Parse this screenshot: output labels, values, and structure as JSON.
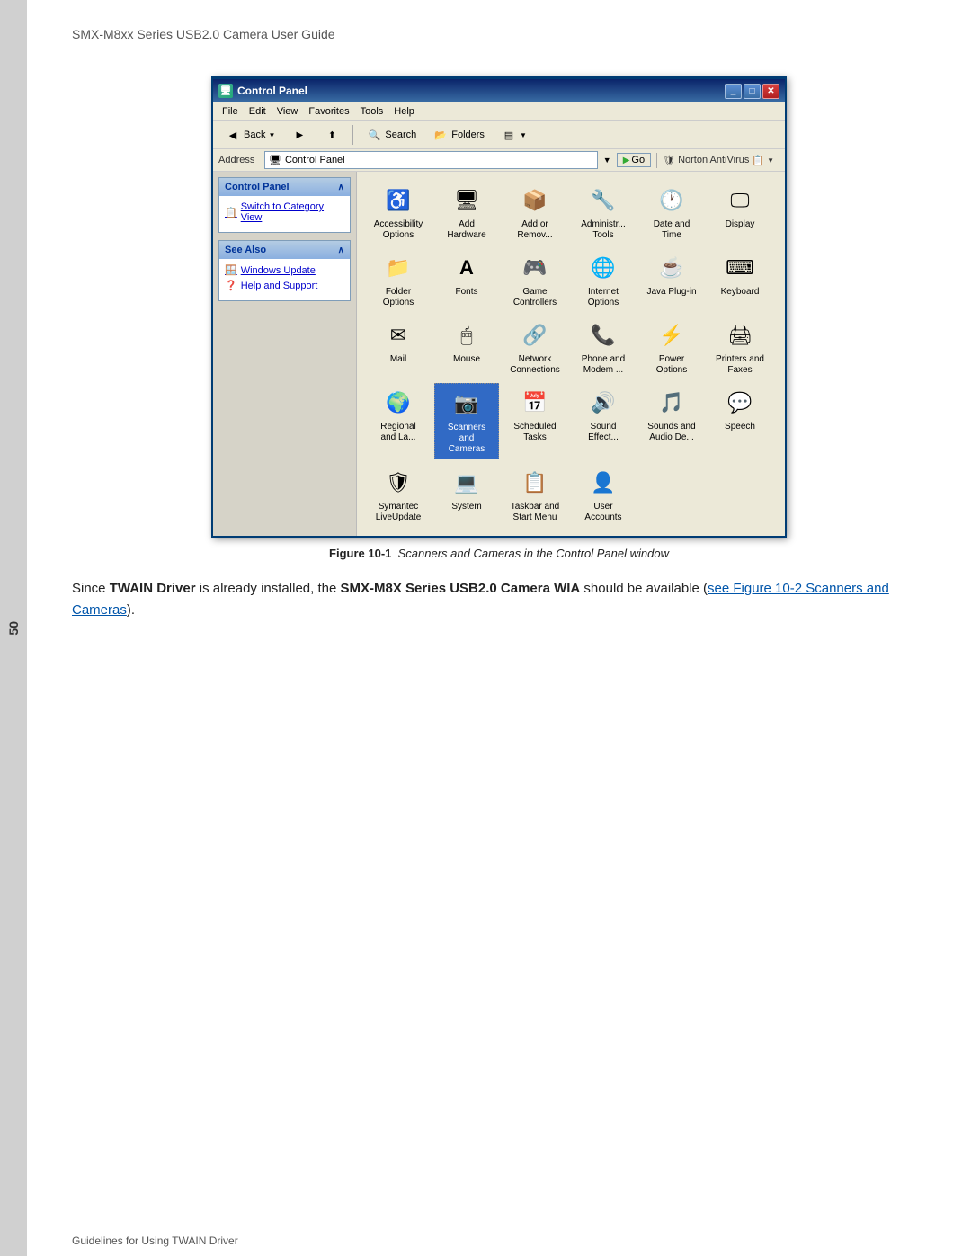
{
  "page": {
    "number": "50",
    "header_title": "SMX-M8xx Series USB2.0 Camera User Guide",
    "footer_title": "Guidelines for Using TWAIN Driver"
  },
  "window": {
    "title": "Control Panel",
    "menus": [
      "File",
      "Edit",
      "View",
      "Favorites",
      "Tools",
      "Help"
    ],
    "toolbar": {
      "back_label": "Back",
      "search_label": "Search",
      "folders_label": "Folders"
    },
    "address": {
      "label": "Address",
      "value": "Control Panel",
      "go_label": "Go"
    },
    "norton_label": "Norton AntiVirus",
    "sidebar": {
      "control_panel_header": "Control Panel",
      "switch_label": "Switch to Category View",
      "see_also_header": "See Also",
      "links": [
        "Windows Update",
        "Help and Support"
      ]
    },
    "icons": [
      {
        "id": "accessibility",
        "label": "Accessibility\nOptions",
        "icon": "♿"
      },
      {
        "id": "hardware",
        "label": "Add\nHardware",
        "icon": "🖥"
      },
      {
        "id": "addremove",
        "label": "Add or\nRemov...",
        "icon": "📦"
      },
      {
        "id": "admintools",
        "label": "Administr...\nTools",
        "icon": "🔧"
      },
      {
        "id": "datetime",
        "label": "Date and\nTime",
        "icon": "🕐"
      },
      {
        "id": "display",
        "label": "Display",
        "icon": "🖵"
      },
      {
        "id": "folderoptions",
        "label": "Folder\nOptions",
        "icon": "📁"
      },
      {
        "id": "fonts",
        "label": "Fonts",
        "icon": "A"
      },
      {
        "id": "game",
        "label": "Game\nControllers",
        "icon": "🎮"
      },
      {
        "id": "internet",
        "label": "Internet\nOptions",
        "icon": "🌐"
      },
      {
        "id": "java",
        "label": "Java Plug-in",
        "icon": "☕"
      },
      {
        "id": "keyboard",
        "label": "Keyboard",
        "icon": "⌨"
      },
      {
        "id": "mail",
        "label": "Mail",
        "icon": "✉"
      },
      {
        "id": "mouse",
        "label": "Mouse",
        "icon": "🖱"
      },
      {
        "id": "network",
        "label": "Network\nConnections",
        "icon": "🔗"
      },
      {
        "id": "phone",
        "label": "Phone and\nModem ...",
        "icon": "📞"
      },
      {
        "id": "power",
        "label": "Power\nOptions",
        "icon": "⚡"
      },
      {
        "id": "printers",
        "label": "Printers and\nFaxes",
        "icon": "🖨"
      },
      {
        "id": "regional",
        "label": "Regional\nand La...",
        "icon": "🌍"
      },
      {
        "id": "scanners",
        "label": "Scanners\nand\nCameras",
        "icon": "📷",
        "selected": true
      },
      {
        "id": "scheduled",
        "label": "Scheduled\nTasks",
        "icon": "📅"
      },
      {
        "id": "sound",
        "label": "Sound\nEffect...",
        "icon": "🔊"
      },
      {
        "id": "soundsaudio",
        "label": "Sounds and\nAudio De...",
        "icon": "🎵"
      },
      {
        "id": "speech",
        "label": "Speech",
        "icon": "💬"
      },
      {
        "id": "symantec",
        "label": "Symantec\nLiveUpdate",
        "icon": "🛡"
      },
      {
        "id": "system",
        "label": "System",
        "icon": "💻"
      },
      {
        "id": "taskbar",
        "label": "Taskbar and\nStart Menu",
        "icon": "🖱"
      },
      {
        "id": "user",
        "label": "User\nAccounts",
        "icon": "👤"
      }
    ]
  },
  "figure_caption": {
    "bold": "Figure 10-1",
    "italic": "Scanners and Cameras in the Control Panel window"
  },
  "body_text": {
    "prefix": "Since ",
    "bold1": "TWAIN Driver",
    "middle1": " is already installed, the ",
    "bold2": "SMX-M8X Series USB2.0 Camera WIA",
    "middle2": " should be available (",
    "link_text": "see Figure 10-2 Scanners and Cameras",
    "suffix": ")."
  }
}
